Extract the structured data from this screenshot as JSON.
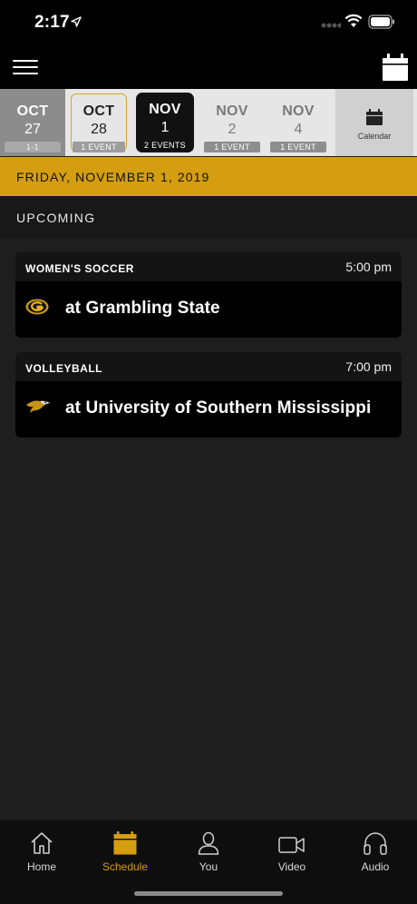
{
  "status_bar": {
    "time": "2:17"
  },
  "date_strip": {
    "past": {
      "month": "OCT",
      "day": "27",
      "badge": "1-1"
    },
    "today": {
      "month": "OCT",
      "day": "28",
      "badge": "1 EVENT"
    },
    "selected": {
      "month": "NOV",
      "day": "1",
      "badge": "2 EVENTS"
    },
    "next1": {
      "month": "NOV",
      "day": "2",
      "badge": "1 EVENT"
    },
    "next2": {
      "month": "NOV",
      "day": "4",
      "badge": "1 EVENT"
    },
    "calendar_label": "Calendar"
  },
  "date_header": "FRIDAY, NOVEMBER 1, 2019",
  "section_label": "UPCOMING",
  "events": [
    {
      "sport": "WOMEN'S SOCCER",
      "time": "5:00 pm",
      "opponent": "at Grambling State",
      "logo_icon": "grambling-g-logo"
    },
    {
      "sport": "VOLLEYBALL",
      "time": "7:00 pm",
      "opponent": "at University of Southern Mississippi",
      "logo_icon": "golden-eagle-logo"
    }
  ],
  "tabs": [
    {
      "label": "Home",
      "icon": "home-icon"
    },
    {
      "label": "Schedule",
      "icon": "calendar-icon"
    },
    {
      "label": "You",
      "icon": "person-icon"
    },
    {
      "label": "Video",
      "icon": "video-camera-icon"
    },
    {
      "label": "Audio",
      "icon": "headphones-icon"
    }
  ],
  "colors": {
    "accent": "#d49e10",
    "background": "#1e1e1e",
    "card": "#000000"
  }
}
